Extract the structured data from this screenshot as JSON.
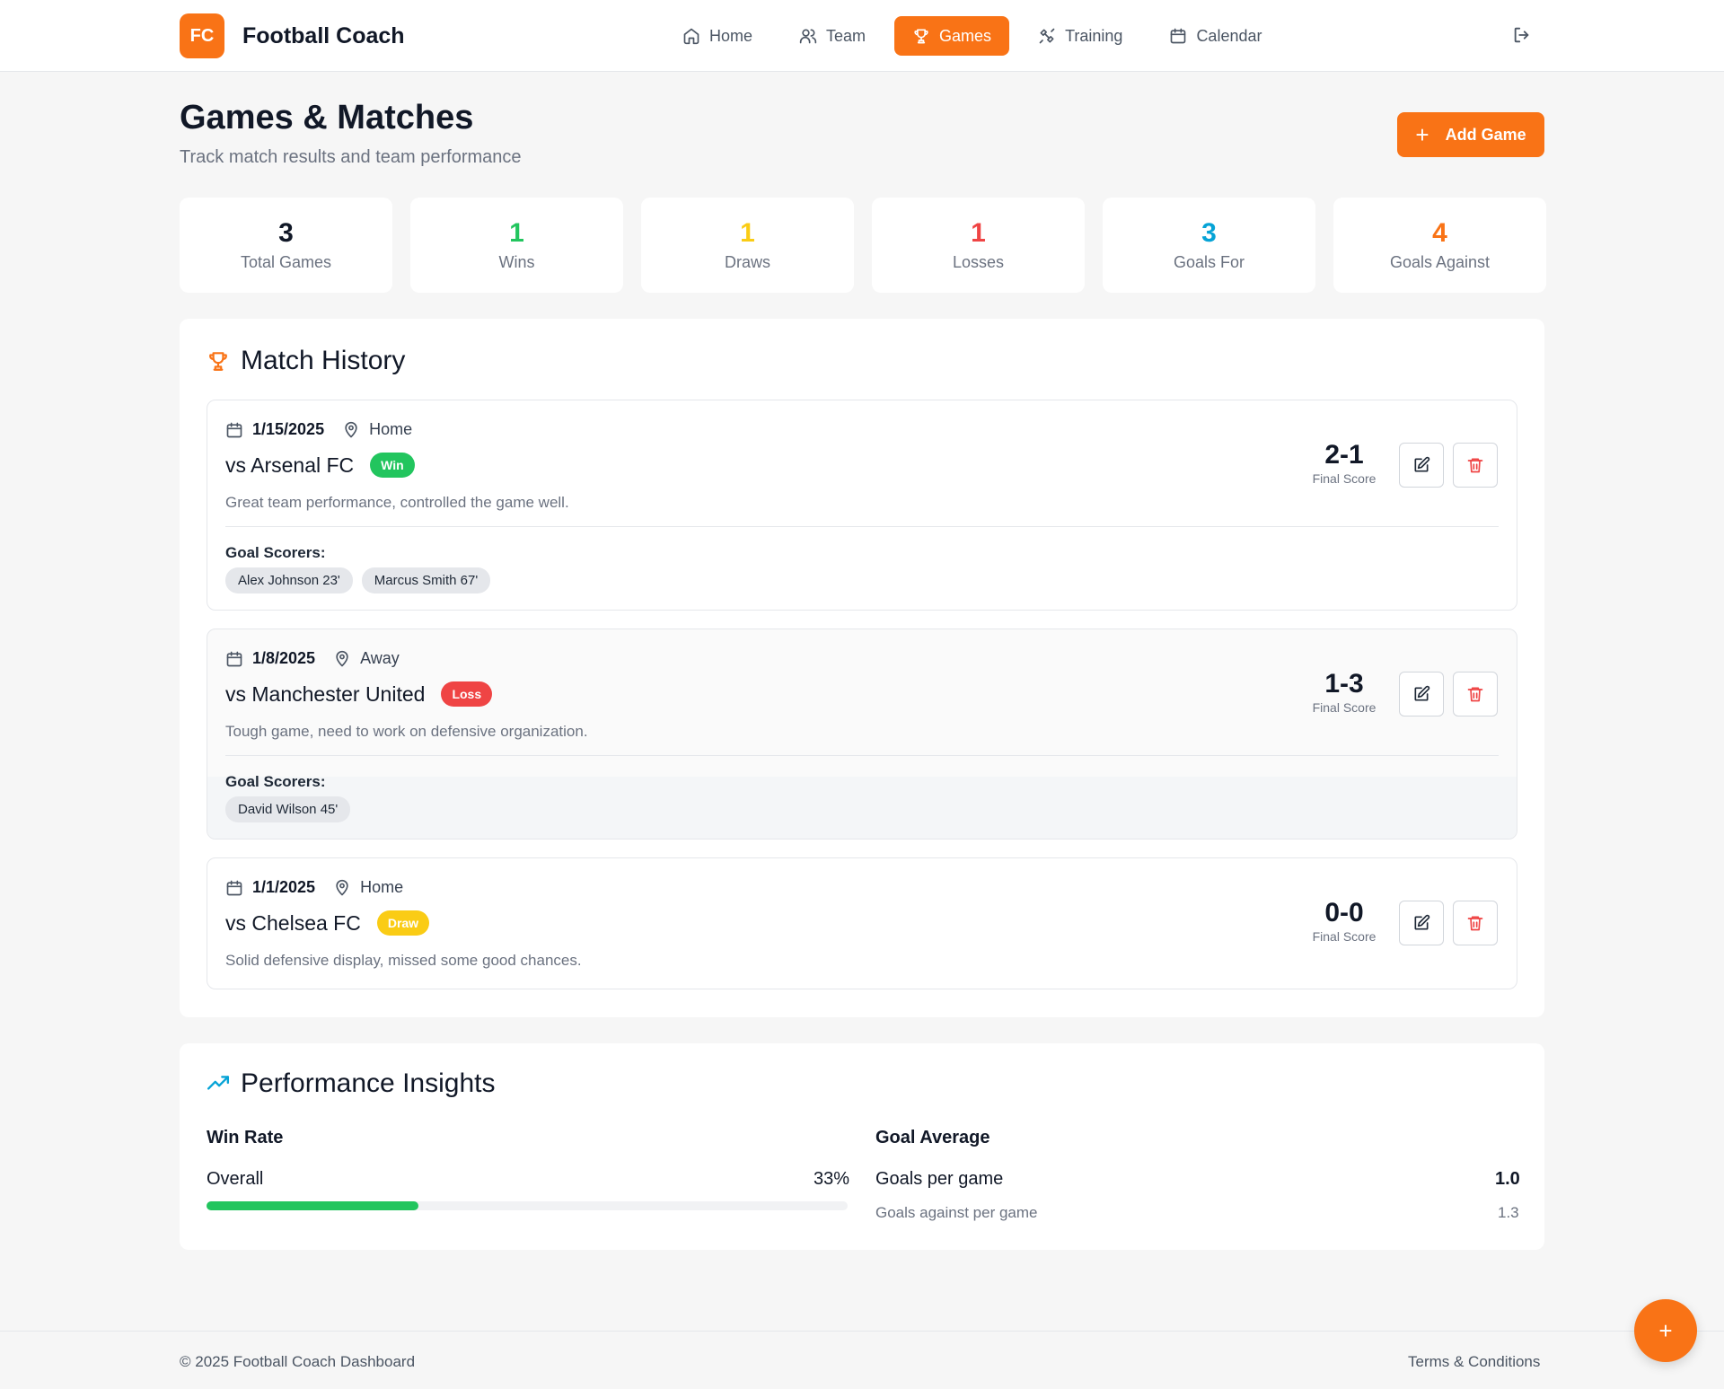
{
  "app": {
    "logo_text": "FC",
    "brand": "Football Coach"
  },
  "nav": [
    {
      "label": "Home",
      "icon": "home-icon",
      "active": false
    },
    {
      "label": "Team",
      "icon": "users-icon",
      "active": false
    },
    {
      "label": "Games",
      "icon": "trophy-icon",
      "active": true
    },
    {
      "label": "Training",
      "icon": "training-icon",
      "active": false
    },
    {
      "label": "Calendar",
      "icon": "calendar-icon",
      "active": false
    }
  ],
  "page": {
    "title": "Games & Matches",
    "subtitle": "Track match results and team performance",
    "add_button": "Add Game"
  },
  "stats": [
    {
      "value": "3",
      "label": "Total Games",
      "color": "#111827"
    },
    {
      "value": "1",
      "label": "Wins",
      "color": "#22c55e"
    },
    {
      "value": "1",
      "label": "Draws",
      "color": "#facc15"
    },
    {
      "value": "1",
      "label": "Losses",
      "color": "#ef4444"
    },
    {
      "value": "3",
      "label": "Goals For",
      "color": "#06a3d6"
    },
    {
      "value": "4",
      "label": "Goals Against",
      "color": "#f97316"
    }
  ],
  "history": {
    "title": "Match History",
    "scorers_label": "Goal Scorers:",
    "score_label": "Final Score",
    "matches": [
      {
        "date": "1/15/2025",
        "location": "Home",
        "opponent": "vs Arsenal FC",
        "result": "Win",
        "result_color": "#22c55e",
        "note": "Great team performance, controlled the game well.",
        "score": "2-1",
        "scorers": [
          "Alex Johnson 23'",
          "Marcus Smith 67'"
        ]
      },
      {
        "date": "1/8/2025",
        "location": "Away",
        "opponent": "vs Manchester United",
        "result": "Loss",
        "result_color": "#ef4444",
        "note": "Tough game, need to work on defensive organization.",
        "score": "1-3",
        "scorers": [
          "David Wilson 45'"
        ]
      },
      {
        "date": "1/1/2025",
        "location": "Home",
        "opponent": "vs Chelsea FC",
        "result": "Draw",
        "result_color": "#facc15",
        "note": "Solid defensive display, missed some good chances.",
        "score": "0-0",
        "scorers": []
      }
    ]
  },
  "insights": {
    "title": "Performance Insights",
    "win_rate": {
      "heading": "Win Rate",
      "label": "Overall",
      "value": "33%",
      "fraction": 0.33
    },
    "goal_average": {
      "heading": "Goal Average",
      "per_game_label": "Goals per game",
      "per_game_value": "1.0",
      "against_label": "Goals against per game",
      "against_value": "1.3"
    }
  },
  "footer": {
    "copyright": "© 2025 Football Coach Dashboard",
    "terms": "Terms & Conditions"
  },
  "fab_label": "+"
}
